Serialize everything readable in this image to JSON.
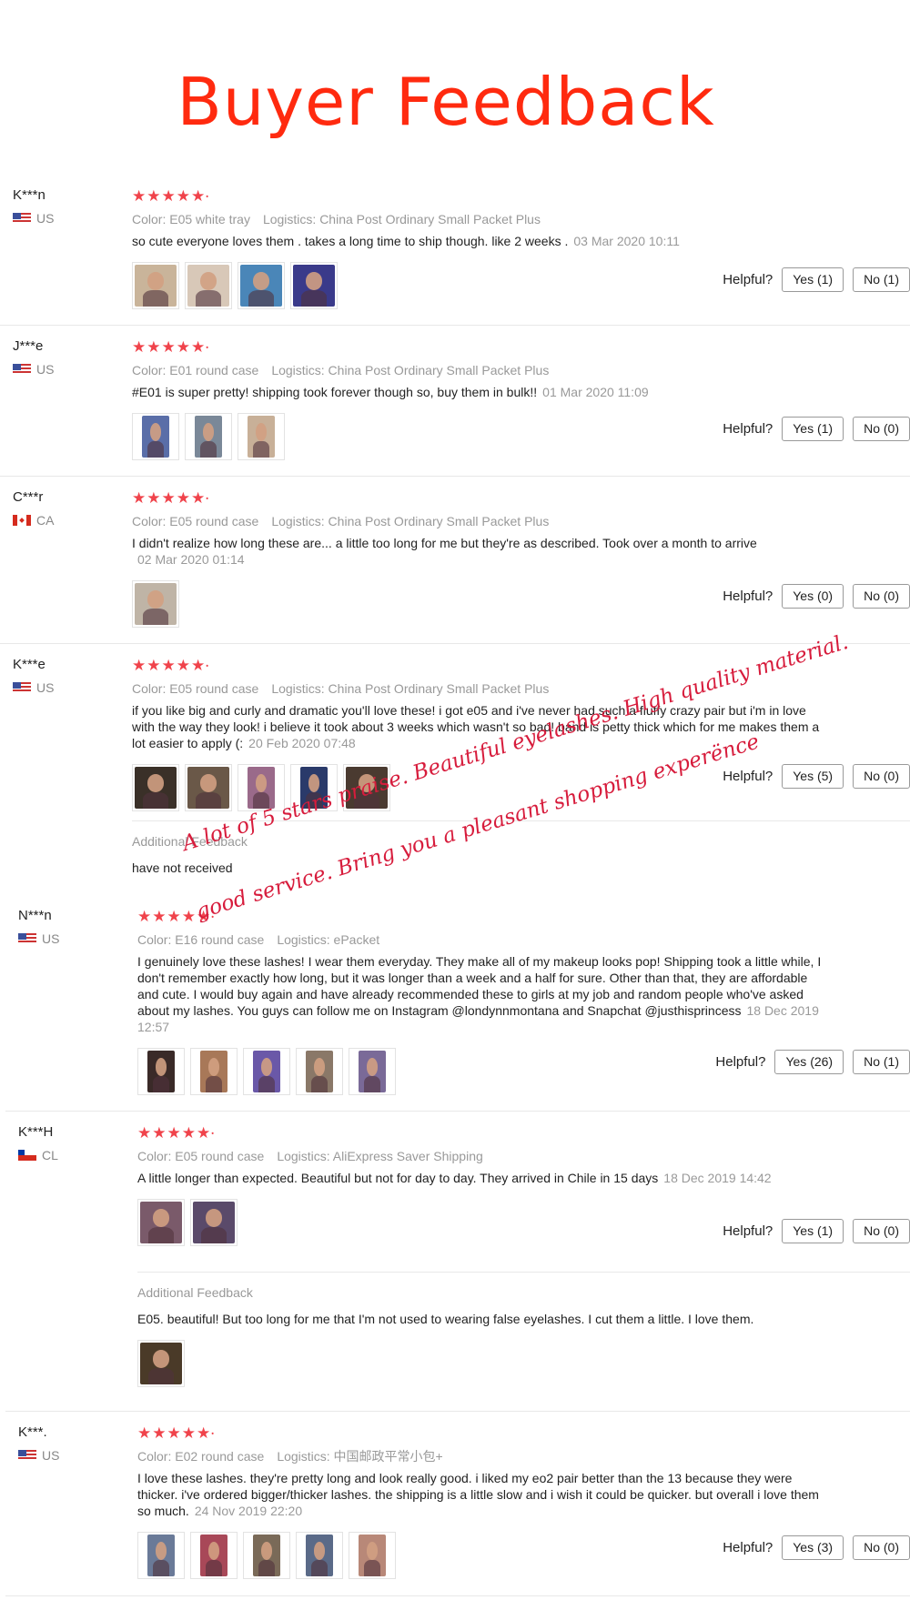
{
  "title": "Buyer Feedback",
  "helpful_label": "Helpful?",
  "additional_label": "Additional Feedback",
  "colors": {
    "title": "#ff2a0f",
    "stars": "#f0434b",
    "watermark": "#d71c3c"
  },
  "watermark": {
    "line1": "A lot of 5 stars praise. Beautiful eyelashes. High quality material.",
    "line2": "good service. Bring you a pleasant shopping experënce"
  },
  "reviews": [
    {
      "name": "K***n",
      "country": "US",
      "flag": "us-flag-icon",
      "stars": "★★★★★",
      "color": "Color: E05 white tray",
      "logistics": "Logistics: China Post Ordinary Small Packet Plus",
      "text": "so cute everyone loves them . takes a long time to ship though. like 2 weeks .",
      "date": "03 Mar 2020 10:11",
      "photos": 4,
      "yes": "Yes (1)",
      "no": "No (1)"
    },
    {
      "name": "J***e",
      "country": "US",
      "flag": "us-flag-icon",
      "stars": "★★★★★",
      "color": "Color: E01 round case",
      "logistics": "Logistics: China Post Ordinary Small Packet Plus",
      "text": "#E01 is super pretty! shipping took forever though so, buy them in bulk!!",
      "date": "01 Mar 2020 11:09",
      "photos": 3,
      "yes": "Yes (1)",
      "no": "No (0)"
    },
    {
      "name": "C***r",
      "country": "CA",
      "flag": "ca-flag-icon",
      "stars": "★★★★★",
      "color": "Color: E05 round case",
      "logistics": "Logistics: China Post Ordinary Small Packet Plus",
      "text": "I didn't realize how long these are... a little too long for me but they're as described. Took over a month to arrive",
      "date": "02 Mar 2020 01:14",
      "photos": 1,
      "yes": "Yes (0)",
      "no": "No (0)"
    },
    {
      "name": "K***e",
      "country": "US",
      "flag": "us-flag-icon",
      "stars": "★★★★★",
      "color": "Color: E05 round case",
      "logistics": "Logistics: China Post Ordinary Small Packet Plus",
      "text": "if you like big and curly and dramatic you'll love these! i got e05 and i've never had such a fluffy crazy pair but i'm in love with the way they look! i believe it took about 3 weeks which wasn't so bad! band is petty thick which for me makes them a lot easier to apply (:",
      "date": "20 Feb 2020 07:48",
      "photos": 5,
      "yes": "Yes (5)",
      "no": "No (0)",
      "additional_text": "have not received"
    },
    {
      "name": "N***n",
      "country": "US",
      "flag": "us-flag-icon",
      "stars": "★★★★★",
      "color": "Color: E16 round case",
      "logistics": "Logistics: ePacket",
      "text": "I genuinely love these lashes! I wear them everyday. They make all of my makeup looks pop! Shipping took a little while, I don't remember exactly how long, but it was longer than a week and a half for sure. Other than that, they are affordable and cute. I would buy again and have already recommended these to girls at my job and random people who've asked about my lashes. You guys can follow me on Instagram @londynnmontana and Snapchat @justhisprincess",
      "date": "18 Dec 2019 12:57",
      "photos": 5,
      "yes": "Yes (26)",
      "no": "No (1)"
    },
    {
      "name": "K***H",
      "country": "CL",
      "flag": "cl-flag-icon",
      "stars": "★★★★★",
      "color": "Color: E05 round case",
      "logistics": "Logistics: AliExpress Saver Shipping",
      "text": "A little longer than expected. Beautiful but not for day to day. They arrived in Chile in 15 days",
      "date": "18 Dec 2019 14:42",
      "photos": 2,
      "yes": "Yes (1)",
      "no": "No (0)",
      "additional_text": "E05. beautiful! But too long for me that I'm not used to wearing false eyelashes. I cut them a little. I love them."
    },
    {
      "name": "K***.",
      "country": "US",
      "flag": "us-flag-icon",
      "stars": "★★★★★",
      "color": "Color: E02 round case",
      "logistics": "Logistics: 中国邮政平常小包+",
      "text": "I love these lashes. they're pretty long and look really good. i liked my eo2 pair better than the 13 because they were thicker. i've ordered bigger/thicker lashes. the shipping is a little slow and i wish it could be quicker. but overall i love them so much.",
      "date": "24 Nov 2019 22:20",
      "photos": 5,
      "yes": "Yes (3)",
      "no": "No (0)"
    }
  ]
}
